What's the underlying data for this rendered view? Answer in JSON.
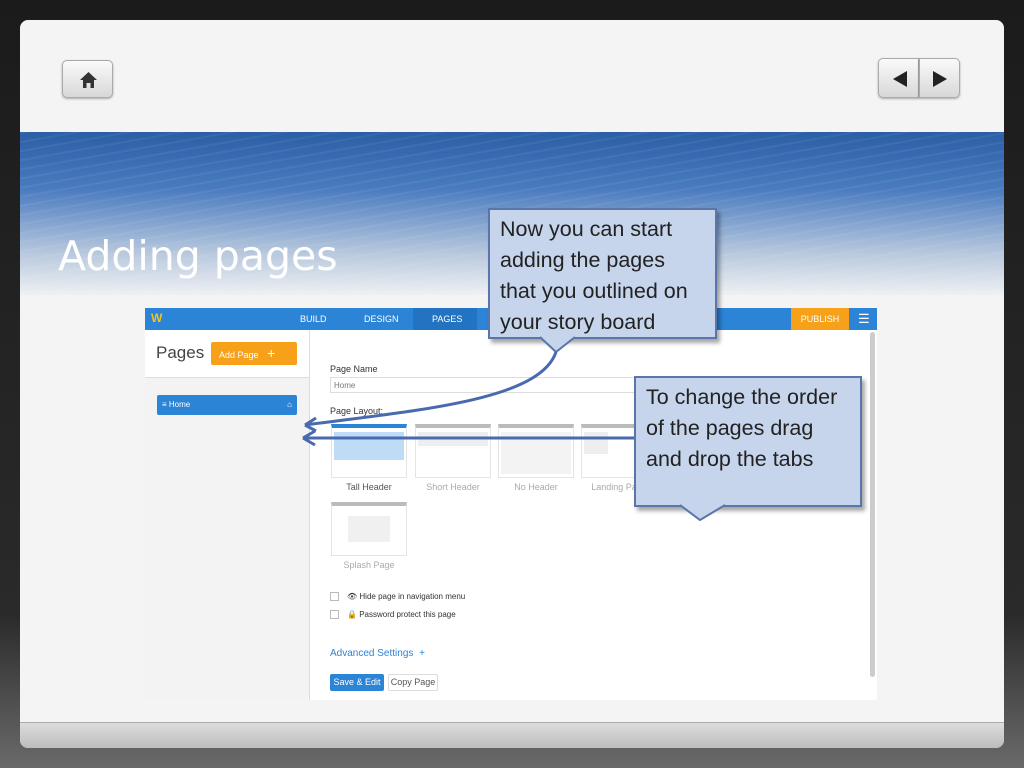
{
  "slide": {
    "title": "Adding pages"
  },
  "icons": {
    "home": "home-icon",
    "prev": "triangle-left-icon",
    "next": "triangle-right-icon"
  },
  "app": {
    "logo": "W",
    "tabs": [
      "BUILD",
      "DESIGN",
      "PAGES"
    ],
    "publish": "PUBLISH",
    "sidebar_title": "Pages",
    "add_page": "Add Page",
    "add_icon": "+",
    "pages": [
      {
        "label": "Home"
      }
    ],
    "page_name_label": "Page Name",
    "page_name_value": "Home",
    "page_layout_label": "Page Layout:",
    "layouts": [
      "Tall Header",
      "Short Header",
      "No Header",
      "Landing Page",
      "Splash Page"
    ],
    "options": [
      "Hide page in navigation menu",
      "Password protect this page"
    ],
    "advanced": "Advanced Settings",
    "advanced_icon": "+",
    "save": "Save & Edit",
    "copy": "Copy Page"
  },
  "callouts": {
    "one": "Now you can start adding the pages that you outlined on your story board",
    "two": "To change the order of the pages drag and drop the tabs"
  },
  "colors": {
    "accent": "#2b84d6",
    "publish": "#f7a11b",
    "callout": "#c6d4ec"
  }
}
